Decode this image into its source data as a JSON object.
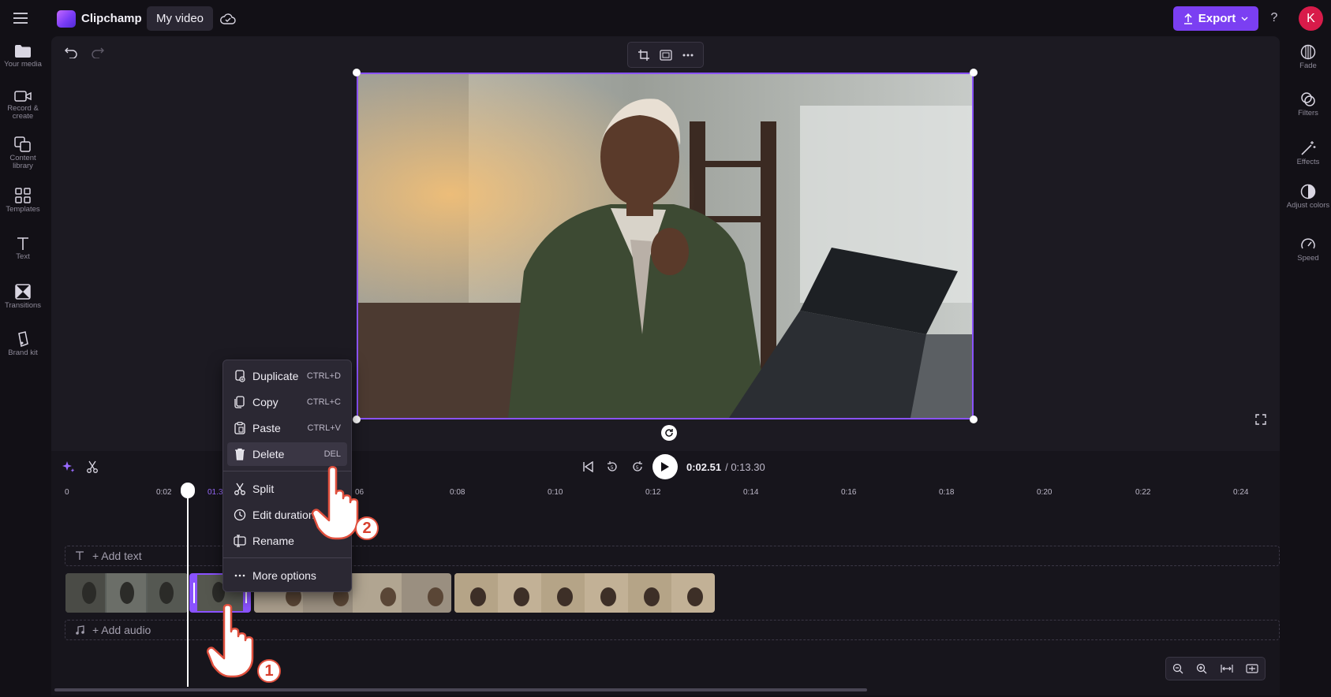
{
  "header": {
    "app_name": "Clipchamp",
    "project_name": "My video",
    "export_label": "Export",
    "help_glyph": "?",
    "avatar_initial": "K"
  },
  "left_sidebar": [
    {
      "label": "Your media",
      "icon": "folder-icon"
    },
    {
      "label": "Record & create",
      "icon": "camera-icon"
    },
    {
      "label": "Content library",
      "icon": "content-library-icon"
    },
    {
      "label": "Templates",
      "icon": "templates-icon"
    },
    {
      "label": "Text",
      "icon": "text-icon"
    },
    {
      "label": "Transitions",
      "icon": "transitions-icon"
    },
    {
      "label": "Brand kit",
      "icon": "brand-kit-icon"
    }
  ],
  "right_sidebar": [
    {
      "label": "Fade",
      "icon": "fade-icon"
    },
    {
      "label": "Filters",
      "icon": "filters-icon"
    },
    {
      "label": "Effects",
      "icon": "effects-wand-icon"
    },
    {
      "label": "Adjust colors",
      "icon": "adjust-colors-icon"
    },
    {
      "label": "Speed",
      "icon": "speed-gauge-icon"
    }
  ],
  "playback": {
    "current_time": "0:02.51",
    "total_time": "/ 0:13.30"
  },
  "ruler": {
    "labels": [
      "0",
      "0:02",
      "01.3",
      "06",
      "0:08",
      "0:10",
      "0:12",
      "0:14",
      "0:16",
      "0:18",
      "0:20",
      "0:22",
      "0:24"
    ]
  },
  "tracks": {
    "text_track": "+ Add text",
    "audio_track": "+ Add audio"
  },
  "context_menu": {
    "items": [
      {
        "label": "Duplicate",
        "shortcut": "CTRL+D",
        "icon": "duplicate-icon"
      },
      {
        "label": "Copy",
        "shortcut": "CTRL+C",
        "icon": "copy-icon"
      },
      {
        "label": "Paste",
        "shortcut": "CTRL+V",
        "icon": "paste-icon"
      },
      {
        "label": "Delete",
        "shortcut": "DEL",
        "icon": "trash-icon"
      },
      {
        "label": "Split",
        "shortcut": "",
        "icon": "scissors-icon"
      },
      {
        "label": "Edit duration",
        "shortcut": "",
        "icon": "clock-icon"
      },
      {
        "label": "Rename",
        "shortcut": "",
        "icon": "rename-icon"
      },
      {
        "label": "More options",
        "shortcut": "",
        "icon": "more-icon"
      }
    ]
  },
  "annotations": {
    "step_one": "1",
    "step_two": "2"
  },
  "colors": {
    "accent": "#7b3ff2",
    "selection": "#8a52ff",
    "avatar": "#d81b4a",
    "background": "#121016",
    "panel": "#1c1a22"
  }
}
